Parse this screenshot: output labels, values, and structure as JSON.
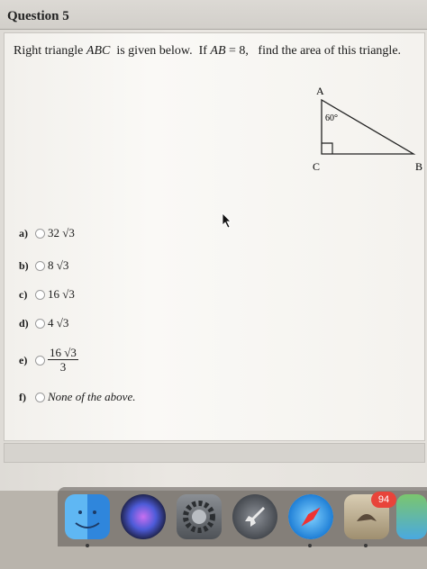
{
  "question": {
    "title": "Question 5",
    "text_pre": "Right triangle ",
    "text_abc": "ABC",
    "text_mid": "  is given below.  If ",
    "text_ab": "AB",
    "text_eq": " = 8,   find the area of this triangle."
  },
  "diagram": {
    "label_a": "A",
    "label_b": "B",
    "label_c": "C",
    "angle": "60°"
  },
  "options": [
    {
      "letter": "a)",
      "text": "32 √3"
    },
    {
      "letter": "b)",
      "text": "8 √3"
    },
    {
      "letter": "c)",
      "text": "16 √3"
    },
    {
      "letter": "d)",
      "text": "4 √3"
    },
    {
      "letter": "e)",
      "numerator": "16 √3",
      "denominator": "3"
    },
    {
      "letter": "f)",
      "text": "None of the above."
    }
  ],
  "dock": {
    "badge": "94",
    "icons": [
      "finder-icon",
      "siri-icon",
      "system-preferences-icon",
      "launchpad-icon",
      "safari-icon",
      "mail-icon",
      "maps-icon"
    ]
  },
  "colors": {
    "badge": "#e8443a",
    "card": "#faf9f6"
  }
}
